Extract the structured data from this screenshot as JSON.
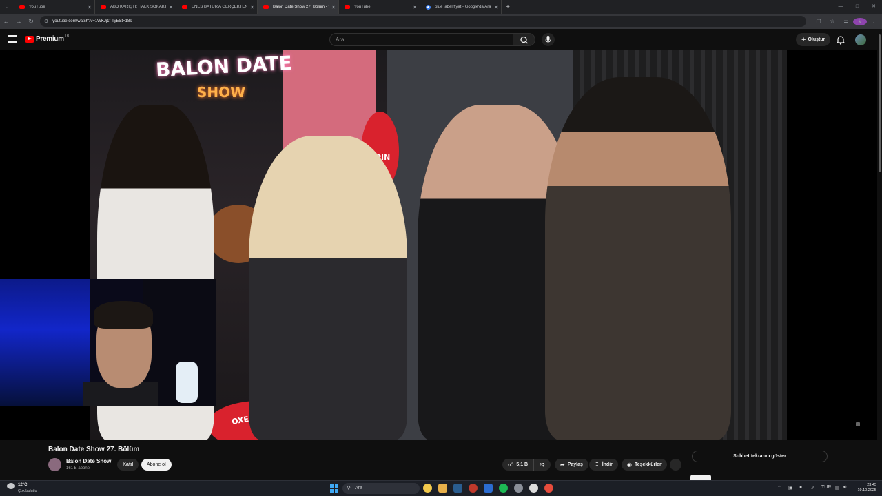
{
  "browser": {
    "tabs": [
      {
        "label": "YouTube",
        "active": false
      },
      {
        "label": "ABD KARIŞTI: HALK SOKAKTA: •",
        "active": false
      },
      {
        "label": "ENES BATUR'A GERÇEKTEN NE",
        "active": false
      },
      {
        "label": "Balon Date Show 27. Bölüm - Y",
        "active": true
      },
      {
        "label": "YouTube",
        "active": false
      },
      {
        "label": "blue label fiyat - Google'da Ara",
        "active": false
      }
    ],
    "new_tab_label": "+",
    "url": "youtube.com/watch?v=1WKJj1f-TyE&t=18s",
    "profile_initial": "k"
  },
  "masthead": {
    "logo_text": "Premium",
    "country_code": "TR",
    "search_placeholder": "Ara",
    "create_label": "Oluştur"
  },
  "video": {
    "sign_line1": "BALON DATE",
    "sign_line2": "SHOW",
    "balloon_brand": "XEPIN",
    "balloon_brand2": "OXEPIN",
    "title": "Balon Date Show 27. Bölüm"
  },
  "channel": {
    "name": "Balon Date Show",
    "subscribers": "161 B abone",
    "join_label": "Katıl",
    "subscribe_label": "Abone ol"
  },
  "actions": {
    "likes": "5,1 B",
    "share_label": "Paylaş",
    "download_label": "İndir",
    "thanks_label": "Teşekkürler",
    "more_label": "⋯"
  },
  "chat": {
    "show_label": "Sohbet tekrarını göster"
  },
  "taskbar": {
    "temperature": "12°C",
    "weather": "Çok bulutlu",
    "search_placeholder": "Ara",
    "language": "TUR",
    "time": "23:45",
    "date": "19.10.2025"
  },
  "colors": {
    "youtube_red": "#ff0000",
    "background": "#0f0f0f",
    "chip_bg": "#272727"
  }
}
